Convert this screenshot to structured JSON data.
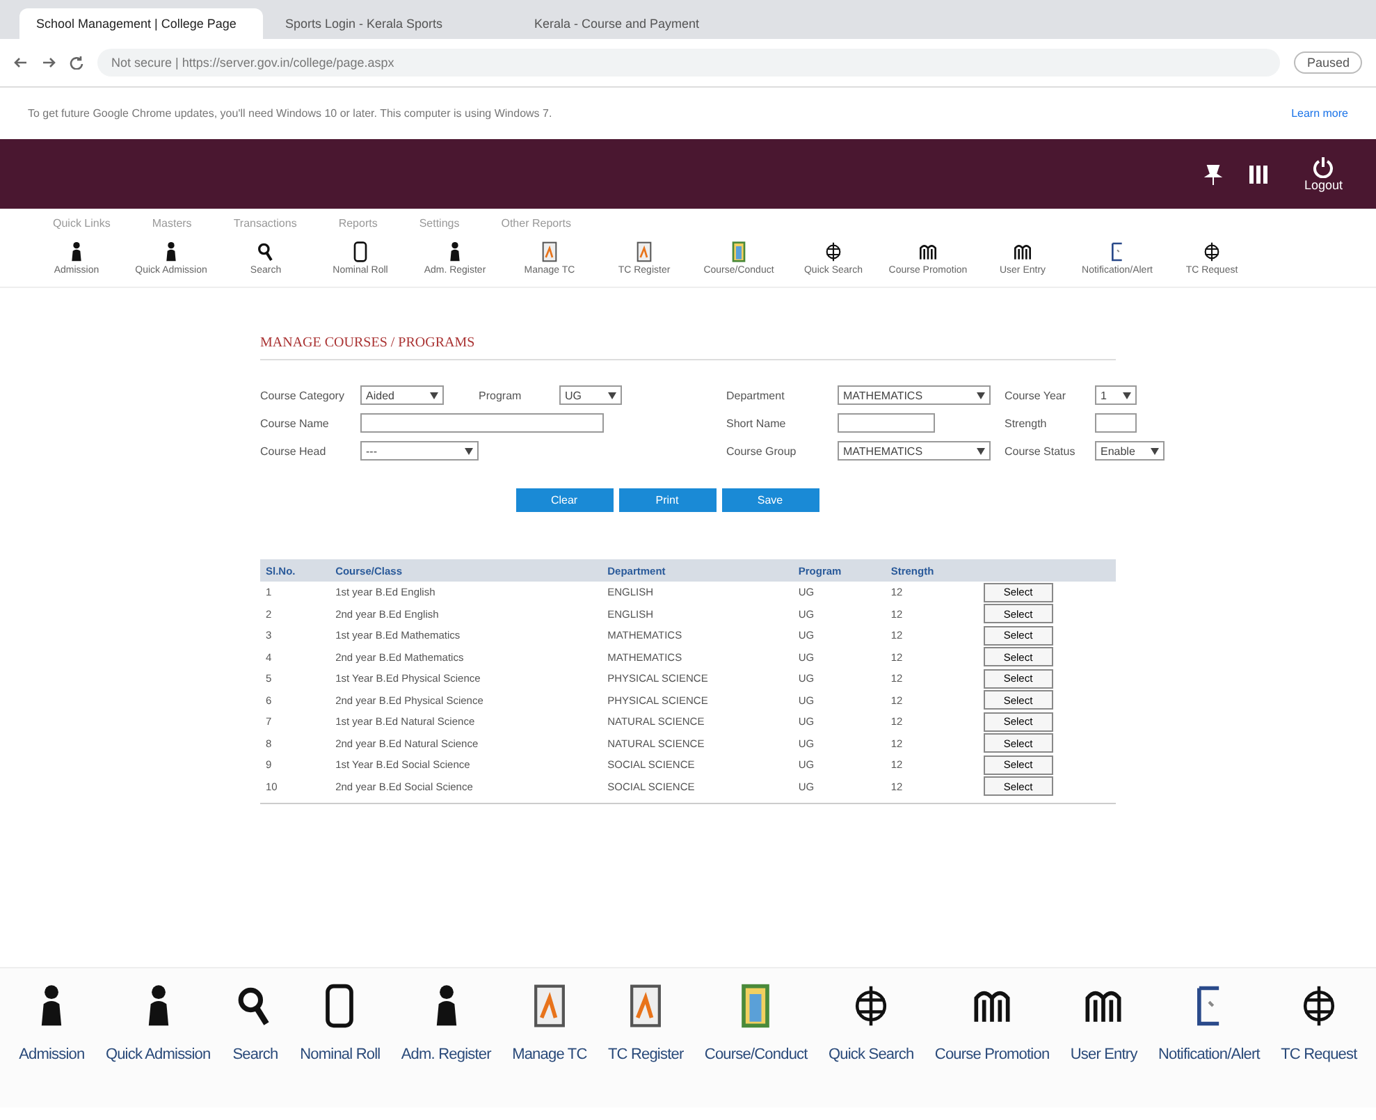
{
  "browser": {
    "tabs": [
      {
        "title": "School Management | College Page",
        "selected": true
      },
      {
        "title": "Sports Login - Kerala Sports",
        "selected": false
      },
      {
        "title": "Kerala - Course and Payment",
        "selected": false
      }
    ],
    "address": "Not secure | https://server.gov.in/college/page.aspx",
    "info_bar": "To get future Google Chrome updates, you'll need Windows 10 or later. This computer is using Windows 7.",
    "info_link": "Learn more",
    "profile": "Paused"
  },
  "header": {
    "logout": "Logout"
  },
  "menu": [
    "Quick Links",
    "Masters",
    "Transactions",
    "Reports",
    "Settings",
    "Other Reports"
  ],
  "toolbar": [
    {
      "label": "Admission",
      "kind": "person"
    },
    {
      "label": "Quick Admission",
      "kind": "person"
    },
    {
      "label": "Search",
      "kind": "search"
    },
    {
      "label": "Nominal Roll",
      "kind": "page"
    },
    {
      "label": "Adm. Register",
      "kind": "person"
    },
    {
      "label": "Manage TC",
      "kind": "doc"
    },
    {
      "label": "TC Register",
      "kind": "doc"
    },
    {
      "label": "Course/Conduct",
      "kind": "book"
    },
    {
      "label": "Quick Search",
      "kind": "globe"
    },
    {
      "label": "Course Promotion",
      "kind": "arch"
    },
    {
      "label": "User Entry",
      "kind": "arch"
    },
    {
      "label": "Notification/Alert",
      "kind": "note"
    },
    {
      "label": "TC Request",
      "kind": "globe"
    }
  ],
  "bottom_toolbar": [
    {
      "label": "Admission",
      "kind": "person"
    },
    {
      "label": "Quick Admission",
      "kind": "person"
    },
    {
      "label": "Search",
      "kind": "search"
    },
    {
      "label": "Nominal Roll",
      "kind": "page"
    },
    {
      "label": "Adm. Register",
      "kind": "person"
    },
    {
      "label": "Manage TC",
      "kind": "doc"
    },
    {
      "label": "TC Register",
      "kind": "doc"
    },
    {
      "label": "Course/Conduct",
      "kind": "book"
    },
    {
      "label": "Quick Search",
      "kind": "globe"
    },
    {
      "label": "Course Promotion",
      "kind": "arch"
    },
    {
      "label": "User Entry",
      "kind": "arch"
    },
    {
      "label": "Notification/Alert",
      "kind": "note"
    },
    {
      "label": "TC Request",
      "kind": "globe"
    }
  ],
  "form": {
    "title": "MANAGE COURSES / PROGRAMS",
    "fields": [
      {
        "label": "Course Category",
        "value": "Aided",
        "kind": "select"
      },
      {
        "label": "Program",
        "value": "UG",
        "kind": "select"
      },
      {
        "label": "Department",
        "value": "MATHEMATICS",
        "kind": "select"
      },
      {
        "label": "Course Year",
        "value": "1",
        "kind": "select"
      },
      {
        "label": "Course Name",
        "kind": "text"
      },
      {
        "label": "Short Name",
        "kind": "text"
      },
      {
        "label": "Strength",
        "kind": "text"
      },
      {
        "label": "Course Head",
        "value": "---",
        "kind": "select"
      },
      {
        "label": "Course Group",
        "value": "MATHEMATICS",
        "kind": "select"
      },
      {
        "label": "Course Status",
        "value": "Enable",
        "kind": "select"
      }
    ],
    "buttons": [
      "Clear",
      "Print",
      "Save"
    ]
  },
  "table": {
    "columns": [
      "Sl.No.",
      "Course/Class",
      "Department",
      "Program",
      "Strength"
    ],
    "rows": [
      {
        "cells": [
          "1",
          "1st year B.Ed English",
          "ENGLISH",
          "UG",
          "12"
        ],
        "action": "Select"
      },
      {
        "cells": [
          "2",
          "2nd year B.Ed English",
          "ENGLISH",
          "UG",
          "12"
        ],
        "action": "Select"
      },
      {
        "cells": [
          "3",
          "1st year B.Ed Mathematics",
          "MATHEMATICS",
          "UG",
          "12"
        ],
        "action": "Select"
      },
      {
        "cells": [
          "4",
          "2nd year B.Ed Mathematics",
          "MATHEMATICS",
          "UG",
          "12"
        ],
        "action": "Select"
      },
      {
        "cells": [
          "5",
          "1st Year B.Ed Physical Science",
          "PHYSICAL SCIENCE",
          "UG",
          "12"
        ],
        "action": "Select"
      },
      {
        "cells": [
          "6",
          "2nd year B.Ed Physical Science",
          "PHYSICAL SCIENCE",
          "UG",
          "12"
        ],
        "action": "Select"
      },
      {
        "cells": [
          "7",
          "1st year B.Ed Natural Science",
          "NATURAL SCIENCE",
          "UG",
          "12"
        ],
        "action": "Select"
      },
      {
        "cells": [
          "8",
          "2nd year B.Ed Natural Science",
          "NATURAL SCIENCE",
          "UG",
          "12"
        ],
        "action": "Select"
      },
      {
        "cells": [
          "9",
          "1st Year B.Ed Social Science",
          "SOCIAL SCIENCE",
          "UG",
          "12"
        ],
        "action": "Select"
      },
      {
        "cells": [
          "10",
          "2nd year B.Ed Social Science",
          "SOCIAL SCIENCE",
          "UG",
          "12"
        ],
        "action": "Select"
      }
    ]
  }
}
